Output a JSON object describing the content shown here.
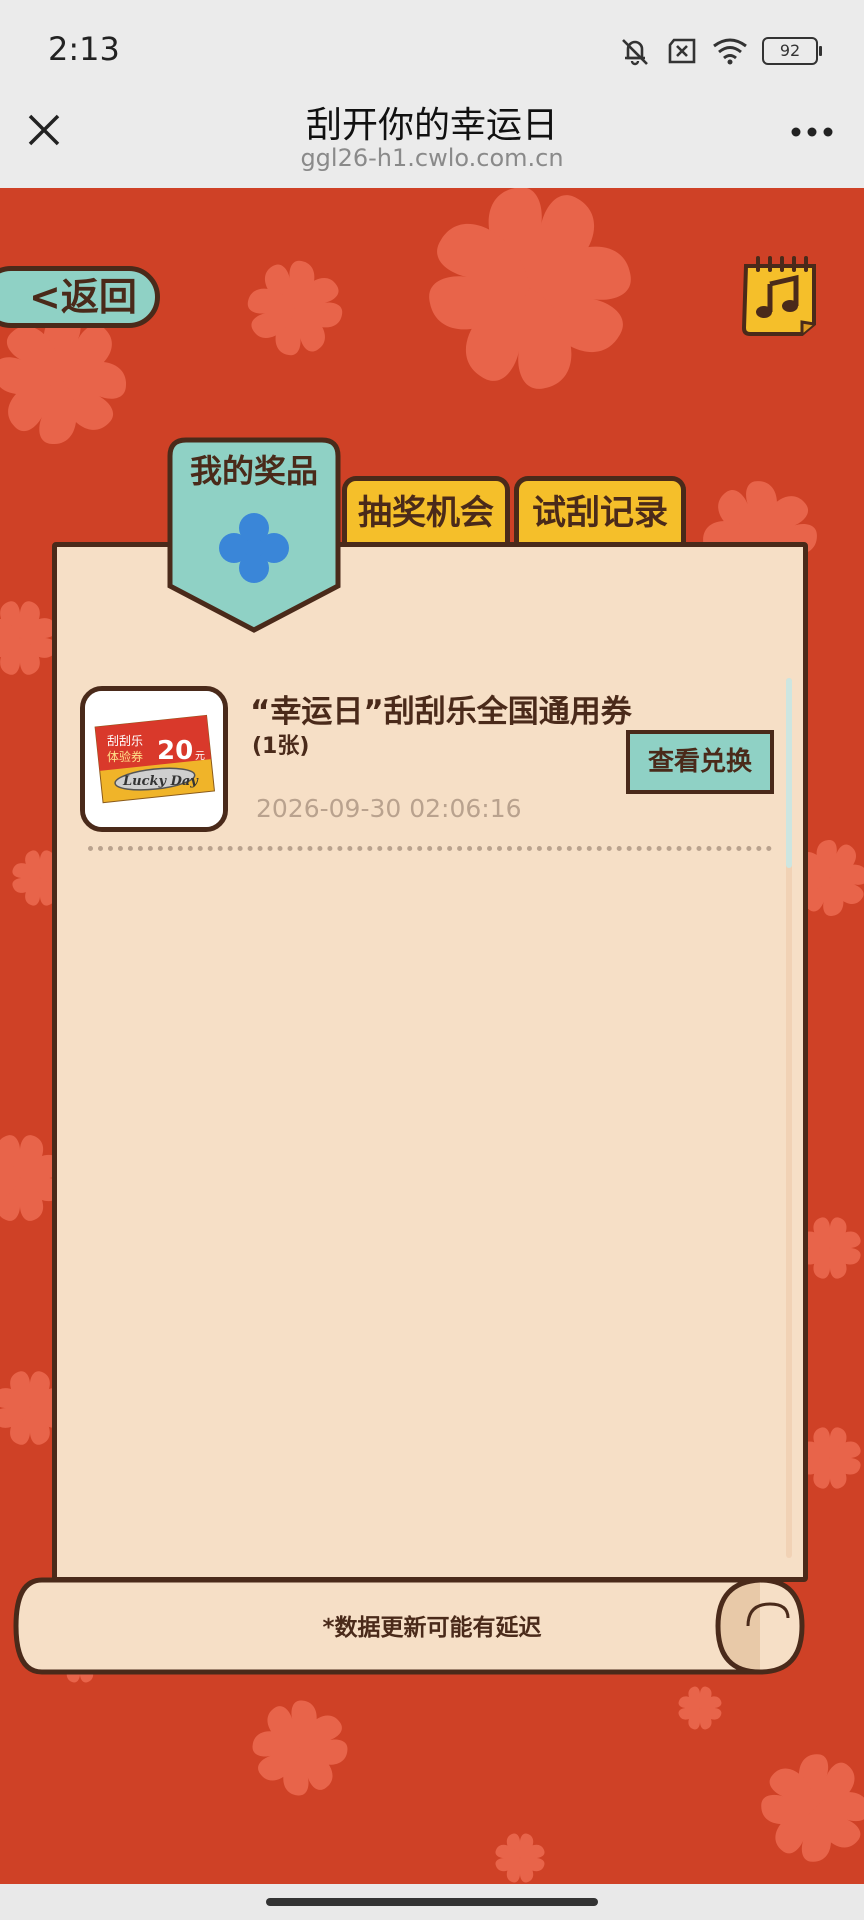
{
  "status_bar": {
    "time": "2:13",
    "battery": "92"
  },
  "browser": {
    "title": "刮开你的幸运日",
    "url": "ggl26-h1.cwlo.com.cn"
  },
  "page": {
    "back_label": "<返回",
    "tabs": [
      {
        "label": "我的奖品",
        "active": true
      },
      {
        "label": "抽奖机会",
        "active": false
      },
      {
        "label": "试刮记录",
        "active": false
      }
    ],
    "prizes": [
      {
        "name": "“幸运日”刮刮乐全国通用券",
        "count": "(1张)",
        "time": "2026-09-30 02:06:16",
        "action_label": "查看兑换",
        "image_text": {
          "line1": "刮刮乐",
          "line2": "体验券",
          "amount": "20",
          "unit": "元",
          "brand": "Lucky Day"
        }
      }
    ],
    "footer_note": "*数据更新可能有延迟"
  },
  "colors": {
    "background": "#cf4126",
    "paper": "#f6dfc6",
    "accent_teal": "#8fd1c5",
    "tab_yellow": "#f5bf2a",
    "outline": "#4a2a1a",
    "clover": "#e8644a"
  }
}
